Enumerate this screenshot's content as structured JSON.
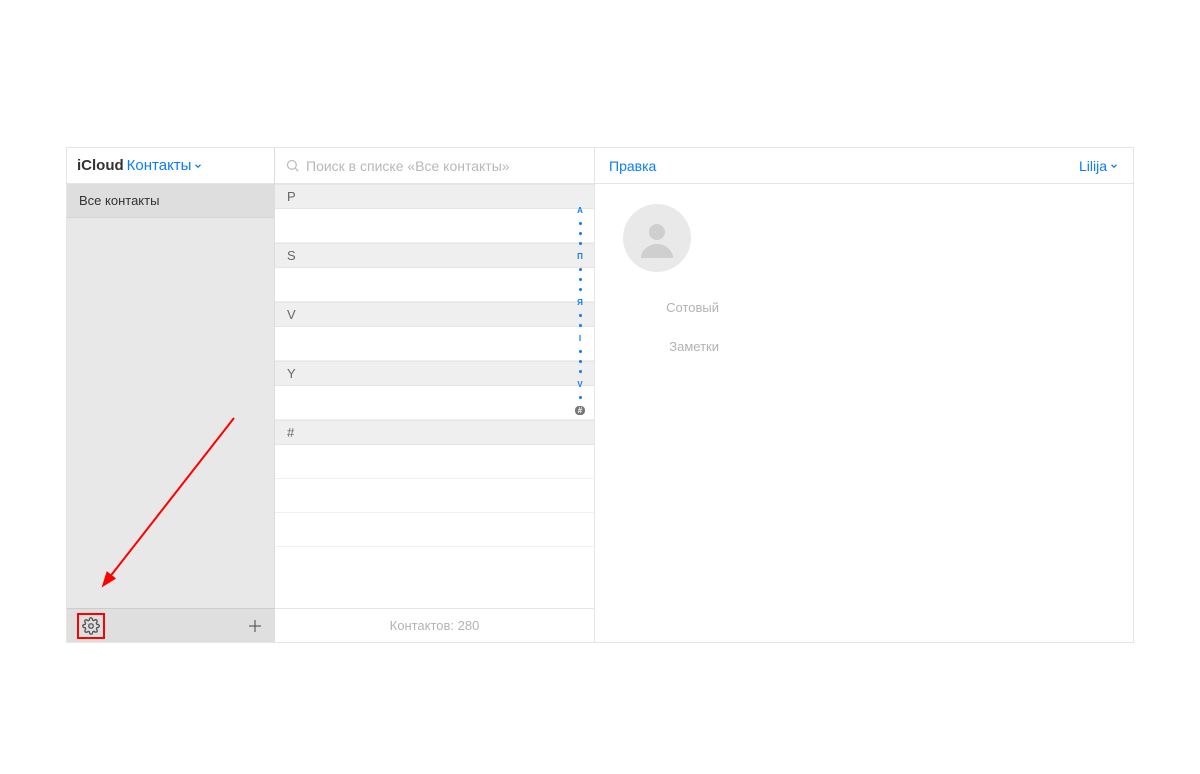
{
  "header": {
    "brand": "iCloud",
    "section": "Контакты"
  },
  "sidebar": {
    "groups": [
      {
        "label": "Все контакты"
      }
    ]
  },
  "search": {
    "placeholder": "Поиск в списке «Все контакты»"
  },
  "list": {
    "sections": [
      "P",
      "S",
      "V",
      "Y",
      "#"
    ],
    "index": [
      "А",
      "",
      "",
      "",
      "П",
      "",
      "",
      "",
      "Я",
      "",
      "",
      "I",
      "",
      "",
      "",
      "V",
      "",
      "#"
    ],
    "footer": "Контактов: 280"
  },
  "detail": {
    "edit_label": "Правка",
    "account_label": "Lilija",
    "fields": {
      "mobile_label": "Сотовый",
      "notes_label": "Заметки"
    }
  }
}
